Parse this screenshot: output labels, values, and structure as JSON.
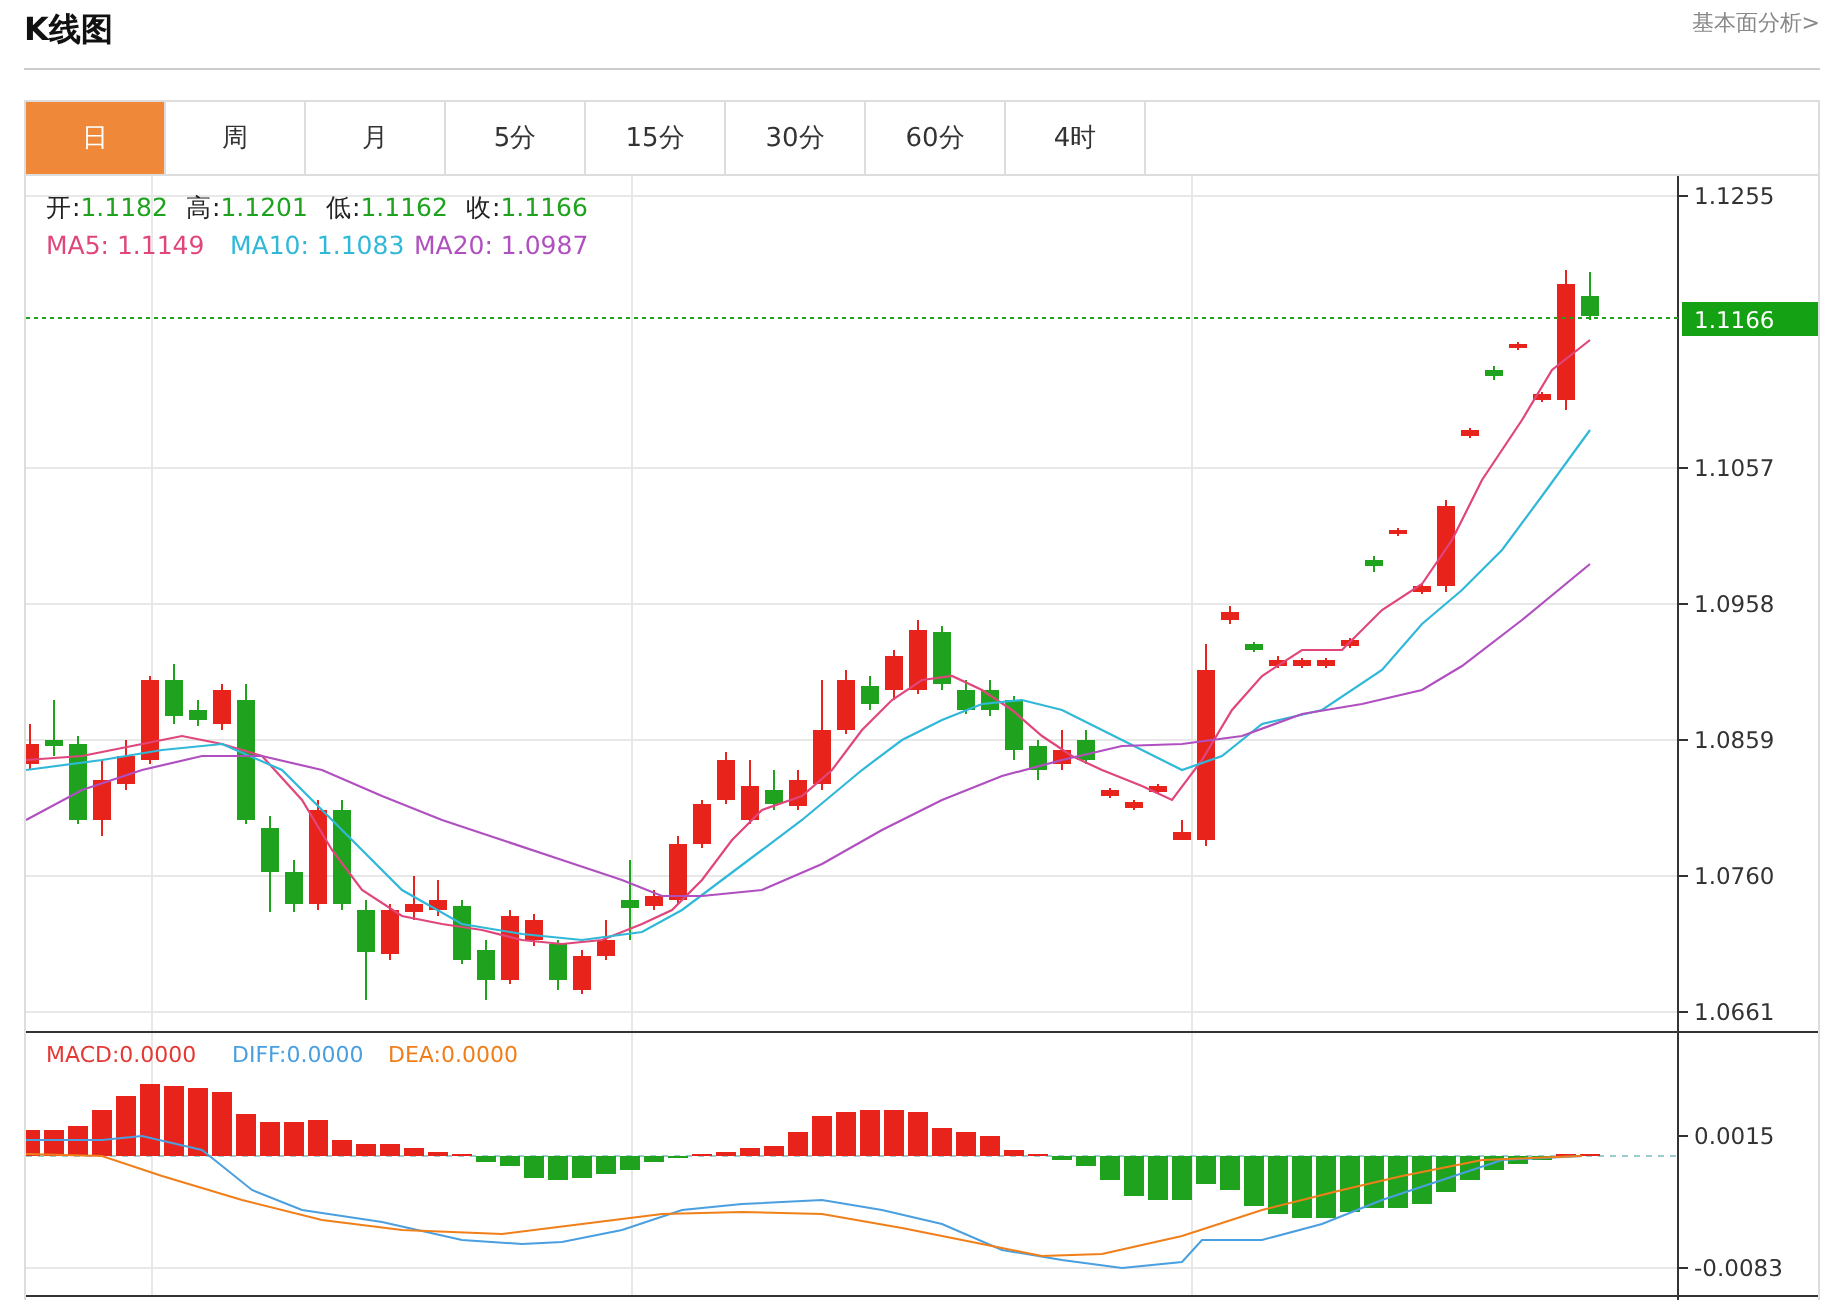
{
  "header": {
    "title": "K线图",
    "link": "基本面分析>"
  },
  "tabs": [
    {
      "label": "日",
      "selected": true
    },
    {
      "label": "周",
      "selected": false
    },
    {
      "label": "月",
      "selected": false
    },
    {
      "label": "5分",
      "selected": false
    },
    {
      "label": "15分",
      "selected": false
    },
    {
      "label": "30分",
      "selected": false
    },
    {
      "label": "60分",
      "selected": false
    },
    {
      "label": "4时",
      "selected": false
    }
  ],
  "quote": [
    {
      "label": "开:",
      "value": "1.1182"
    },
    {
      "label": "高:",
      "value": "1.1201"
    },
    {
      "label": "低:",
      "value": "1.1162"
    },
    {
      "label": "收:",
      "value": "1.1166"
    }
  ],
  "ma_legend": [
    {
      "label": "MA5: 1.1149",
      "color": "#e0467c"
    },
    {
      "label": "MA10: 1.1083",
      "color": "#30b8d8"
    },
    {
      "label": "MA20: 1.0987",
      "color": "#b050c0"
    }
  ],
  "price_axis": {
    "ticks": [
      "1.1255",
      "1.1057",
      "1.0958",
      "1.0859",
      "1.0760",
      "1.0661"
    ],
    "last_price": "1.1166"
  },
  "macd": {
    "legend": [
      {
        "label": "MACD:0.0000",
        "color": "#e53935"
      },
      {
        "label": "DIFF:0.0000",
        "color": "#4a9fe0"
      },
      {
        "label": "DEA:0.0000",
        "color": "#f07f1a"
      }
    ],
    "ticks": [
      "0.0015",
      "-0.0083"
    ]
  }
}
